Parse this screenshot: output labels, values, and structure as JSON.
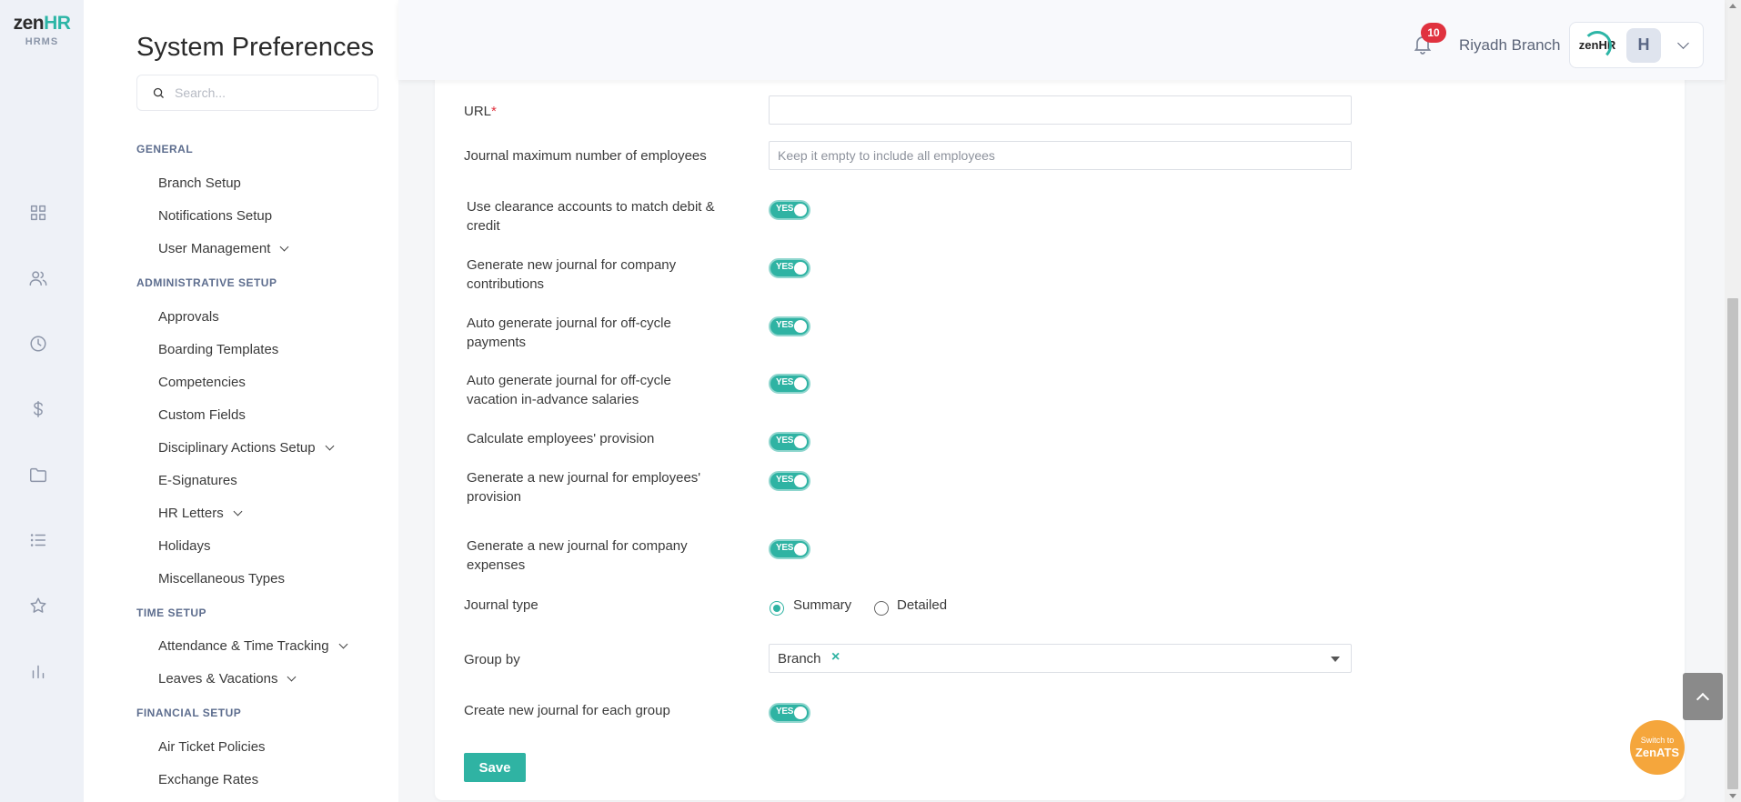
{
  "brand": {
    "logo_main": "zen",
    "logo_accent": "HR",
    "logo_sub": "HRMS"
  },
  "rail_icons": [
    "dashboard-icon",
    "people-icon",
    "clock-icon",
    "dollar-icon",
    "folder-icon",
    "list-icon",
    "star-icon",
    "bar-chart-icon"
  ],
  "sidebar": {
    "title": "System Preferences",
    "search_placeholder": "Search...",
    "sections": [
      {
        "heading": "GENERAL",
        "items": [
          "Branch Setup",
          "Notifications Setup",
          "User Management"
        ]
      },
      {
        "heading": "ADMINISTRATIVE SETUP",
        "items": [
          "Approvals",
          "Boarding Templates",
          "Competencies",
          "Custom Fields",
          "Disciplinary Actions Setup",
          "E-Signatures",
          "HR Letters",
          "Holidays",
          "Miscellaneous Types"
        ]
      },
      {
        "heading": "TIME SETUP",
        "items": [
          "Attendance & Time Tracking",
          "Leaves & Vacations"
        ]
      },
      {
        "heading": "FINANCIAL SETUP",
        "items": [
          "Air Ticket Policies",
          "Exchange Rates"
        ]
      }
    ]
  },
  "header": {
    "notification_count": "10",
    "branch_name": "Riyadh Branch",
    "chip_logo": "zenHR",
    "avatar_initial": "H"
  },
  "form": {
    "url_label": "URL",
    "url_required": "*",
    "url_value": "",
    "max_employees_label": "Journal maximum number of employees",
    "max_employees_placeholder": "Keep it empty to include all employees",
    "toggle_text": "YES",
    "toggles": [
      {
        "label": "Use clearance accounts to match debit & credit",
        "on": true
      },
      {
        "label": "Generate new journal for company contributions",
        "on": true
      },
      {
        "label": "Auto generate journal for off-cycle payments",
        "on": true
      },
      {
        "label": "Auto generate journal for off-cycle vacation in-advance salaries",
        "on": true
      },
      {
        "label": "Calculate employees' provision",
        "on": true
      },
      {
        "label": "Generate a new journal for employees' provision",
        "on": true
      },
      {
        "label": "Generate a new journal for company expenses",
        "on": true
      }
    ],
    "journal_type_label": "Journal type",
    "journal_type_options": [
      "Summary",
      "Detailed"
    ],
    "journal_type_selected": "Summary",
    "group_by_label": "Group by",
    "group_by_value": "Branch",
    "group_by_remove": "×",
    "each_group_label": "Create new journal for each group",
    "each_group_on": true,
    "save_label": "Save"
  },
  "floating": {
    "switch_line1": "Switch to",
    "switch_line2": "ZenATS"
  },
  "colors": {
    "accent": "#2fb3a3",
    "badge": "#e0323f",
    "switch_ats": "#f5a63c"
  }
}
